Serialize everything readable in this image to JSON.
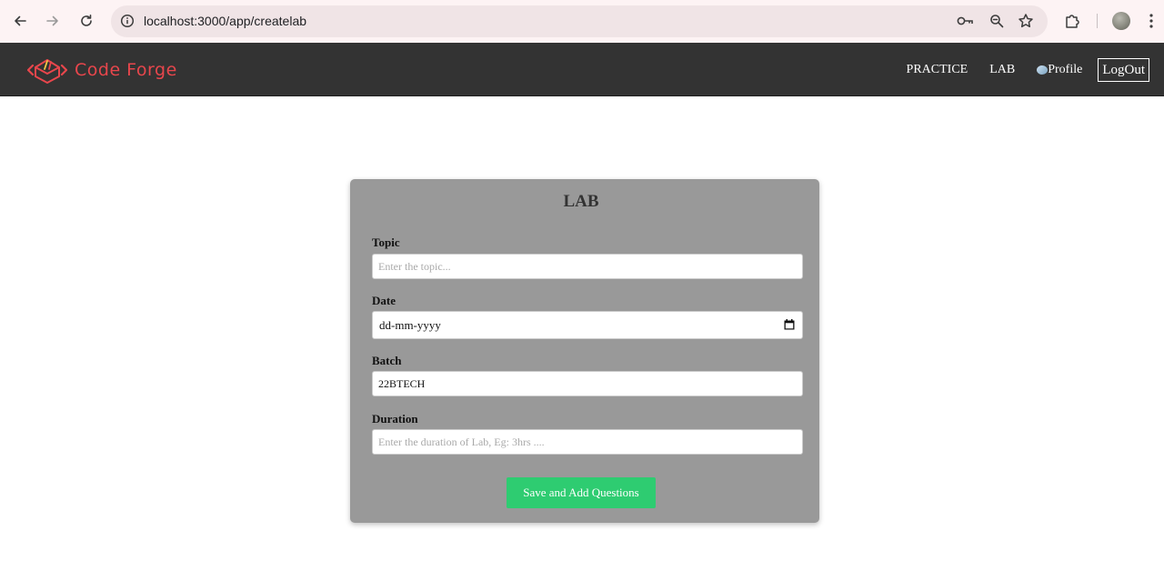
{
  "browser": {
    "url": "localhost:3000/app/createlab"
  },
  "navbar": {
    "brand": "Code Forge",
    "links": {
      "practice": "PRACTICE",
      "lab": "LAB",
      "profile": "Profile",
      "logout": "LogOut"
    }
  },
  "form": {
    "title": "LAB",
    "topic": {
      "label": "Topic",
      "placeholder": "Enter the topic...",
      "value": ""
    },
    "date": {
      "label": "Date",
      "value": "dd-mm-yyyy"
    },
    "batch": {
      "label": "Batch",
      "value": "22BTECH"
    },
    "duration": {
      "label": "Duration",
      "placeholder": "Enter the duration of Lab, Eg: 3hrs ....",
      "value": ""
    },
    "submit_label": "Save and Add Questions"
  },
  "colors": {
    "navbar_bg": "#333333",
    "brand": "#e8464c",
    "card_bg": "#999999",
    "submit_bg": "#2ecc71"
  }
}
